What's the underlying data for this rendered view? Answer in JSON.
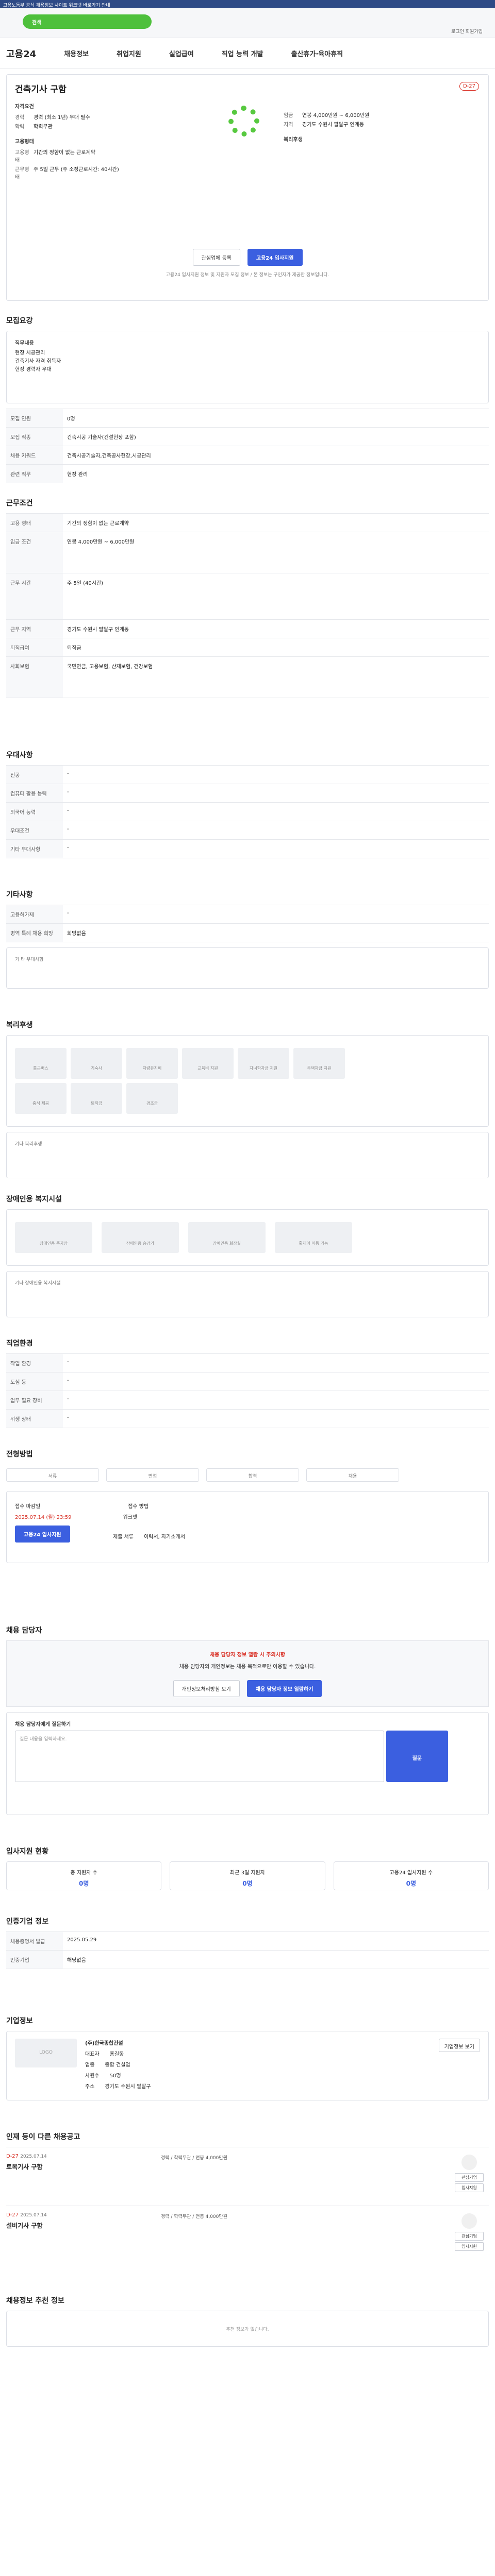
{
  "topbar": {
    "text": "고용노동부 공식 채용정보 사이트 워크넷 바로가기 안내"
  },
  "search": {
    "label": "검색"
  },
  "util": {
    "text": "로그인 회원가입"
  },
  "gnb": {
    "logo": "고용24",
    "menus": [
      "채용정보",
      "취업지원",
      "실업급여",
      "직업 능력 개발",
      "출산휴가·육아휴직",
      "전체메뉴"
    ]
  },
  "job": {
    "title": "건축기사 구함",
    "dday": "D-27",
    "sec1": "자격요건",
    "k1": "경력",
    "v1": "경력 (최소 1년) 우대 필수",
    "k2": "학력",
    "v2": "학력무관",
    "sec2": "고용형태",
    "k3": "고용형태",
    "v3": "기간의 정함이 없는 근로계약",
    "k4": "근무형태",
    "v4": "주 5일 근무 (주 소정근로시간: 40시간)",
    "r1k": "임금",
    "r1v": "연봉 4,000만원 ~ 6,000만원",
    "r2k": "지역",
    "r2v": "경기도 수원시 팔달구 인계동",
    "r3k": "복리후생",
    "btn_scrap": "관심업체 등록",
    "btn_apply": "고용24 입사지원",
    "note": "고용24 입사지원 정보 및 지원자 모집 정보 / 본 정보는 구인자가 제공한 정보입니다."
  },
  "sections": {
    "s1": "모집요강",
    "s2": "근무조건",
    "s3": "우대사항",
    "s4": "기타사항",
    "s5": "복리후생",
    "s6": "장애인용 복지시설",
    "s7": "직업환경",
    "s8": "전형방법",
    "s9": "채용 담당자",
    "s10": "입사지원 현황",
    "s11": "인증기업 정보",
    "s12": "기업정보",
    "s13": "인재 등이 다른 채용공고",
    "s14": "채용정보 추천 정보"
  },
  "recruit": {
    "head": "직무내용",
    "body": "현장 시공관리\n건축기사 자격 취득자\n현장 경력자 우대",
    "rows": [
      [
        "모집 인원",
        "0명"
      ],
      [
        "모집 직종",
        "건축시공 기술자(건설현장 포함)"
      ],
      [
        "채용 키워드",
        "건축시공기술자,건축공사현장,시공관리"
      ],
      [
        "관련 직무",
        "현장 관리"
      ]
    ]
  },
  "cond": {
    "rows": [
      [
        "고용 형태",
        "기간의 정함이 없는 근로계약"
      ],
      [
        "임금 조건",
        "연봉 4,000만원 ~ 6,000만원"
      ],
      [
        "근무 시간",
        "주 5일 (40시간)"
      ],
      [
        "근무 지역",
        "경기도 수원시 팔달구 인계동"
      ],
      [
        "퇴직급여",
        "퇴직금"
      ],
      [
        "사회보험",
        "국민연금, 고용보험, 산재보험, 건강보험"
      ]
    ]
  },
  "pref": {
    "rows": [
      [
        "전공",
        "-"
      ],
      [
        "컴퓨터 활용 능력",
        "-"
      ],
      [
        "외국어 능력",
        "-"
      ],
      [
        "우대조건",
        "-"
      ],
      [
        "기타 우대사항",
        "-"
      ]
    ]
  },
  "etc": {
    "rows": [
      [
        "고용허가제",
        "-"
      ],
      [
        "병역 특례 채용 희망",
        "희망없음"
      ]
    ],
    "link": "기 타 우대사항"
  },
  "welfare": {
    "tiles": [
      "통근버스",
      "기숙사",
      "차량유지비",
      "교육비 지원",
      "자녀학자금 지원",
      "주택자금 지원",
      "중식 제공",
      "퇴직금",
      "경조금"
    ],
    "more": "기타 복리후생"
  },
  "access": {
    "tiles": [
      "장애인용 주차장",
      "장애인용 승강기",
      "장애인용 화장실",
      "휠체어 이동 가능"
    ],
    "more": "기타 장애인용 복지시설"
  },
  "env": {
    "rows": [
      [
        "작업 환경",
        "-"
      ],
      [
        "도심 등",
        "-"
      ],
      [
        "업무 필요 장비",
        "-"
      ],
      [
        "위생 상태",
        "-"
      ]
    ]
  },
  "process": {
    "steps": [
      "서류",
      "면접",
      "합격",
      "채용"
    ],
    "k1": "접수 마감일",
    "v1": "2025.07.14 (월) 23:59",
    "k2": "접수 방법",
    "v2": "워크넷",
    "apply": "고용24 입사지원",
    "k3": "제출 서류",
    "v3": "이력서, 자기소개서"
  },
  "contact": {
    "alert": "채용 담당자 정보 열람 시 주의사항",
    "desc": "채용 담당자의 개인정보는 채용 목적으로만 이용할 수 있습니다.",
    "b1": "개인정보처리방침 보기",
    "b2": "채용 담당자 정보 열람하기",
    "qtitle": "채용 담당자에게 질문하기",
    "placeholder": "질문 내용을 입력하세요.",
    "submit": "질문"
  },
  "stats": {
    "items": [
      [
        "총 지원자 수",
        "0명"
      ],
      [
        "최근 3일 지원자",
        "0명"
      ],
      [
        "고용24 입사지원 수",
        "0명"
      ]
    ]
  },
  "cert": {
    "title": "인증기업 정보",
    "rows": [
      [
        "채용증명서 발급",
        "2025.05.29"
      ],
      [
        "인증기업",
        "해당없음"
      ]
    ]
  },
  "company": {
    "logo": "LOGO",
    "name": "(주)한국종합건설",
    "rows": [
      [
        "대표자",
        "홍길동"
      ],
      [
        "업종",
        "종합 건설업"
      ],
      [
        "사원수",
        "50명"
      ],
      [
        "주소",
        "경기도 수원시 팔달구"
      ]
    ],
    "btn": "기업정보 보기"
  },
  "others": {
    "items": [
      {
        "d": "D-27",
        "date": "2025.07.14",
        "t": "토목기사 구함",
        "mid": "경력 / 학력무관 / 연봉 4,000만원"
      },
      {
        "d": "D-27",
        "date": "2025.07.14",
        "t": "설비기사 구함",
        "mid": "경력 / 학력무관 / 연봉 4,000만원"
      }
    ],
    "b1": "관심기업",
    "b2": "입사지원"
  },
  "reco": {
    "empty": "추천 정보가 없습니다."
  }
}
